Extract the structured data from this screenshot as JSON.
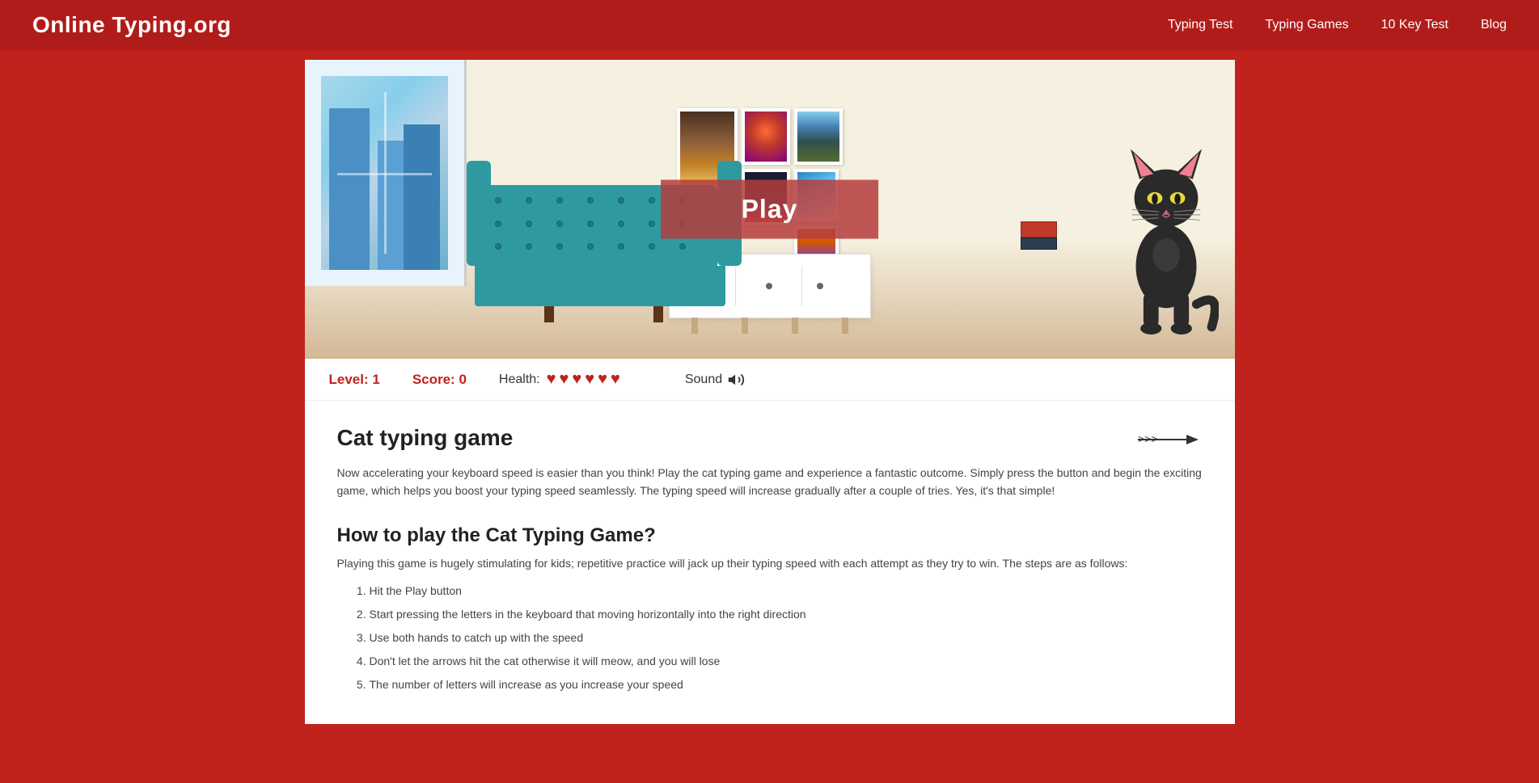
{
  "header": {
    "logo": "Online Typing.org",
    "nav": [
      {
        "label": "Typing Test",
        "href": "#"
      },
      {
        "label": "Typing Games",
        "href": "#"
      },
      {
        "label": "10 Key Test",
        "href": "#"
      },
      {
        "label": "Blog",
        "href": "#"
      }
    ]
  },
  "game": {
    "play_button": "Play",
    "level_label": "Level: 1",
    "score_label": "Score: 0",
    "health_label": "Health:",
    "hearts_count": 6,
    "sound_label": "Sound"
  },
  "page": {
    "title": "Cat typing game",
    "arrow": ">>>—",
    "description": "Now accelerating your keyboard speed is easier than you think! Play the cat typing game and experience a fantastic outcome. Simply press the button and begin the exciting game, which helps you boost your typing speed seamlessly. The typing speed will increase gradually after a couple of tries. Yes, it's that simple!",
    "section_title": "How to play the Cat Typing Game?",
    "section_desc": "Playing this game is hugely stimulating for kids; repetitive practice will jack up their typing speed with each attempt as they try to win. The steps are as follows:",
    "instructions": [
      "Hit the Play button",
      "Start pressing the letters in the keyboard that moving horizontally into the right direction",
      "Use both hands to catch up with the speed",
      "Don't let the arrows hit the cat otherwise it will meow, and you will lose",
      "The number of letters will increase as you increase your speed"
    ]
  }
}
